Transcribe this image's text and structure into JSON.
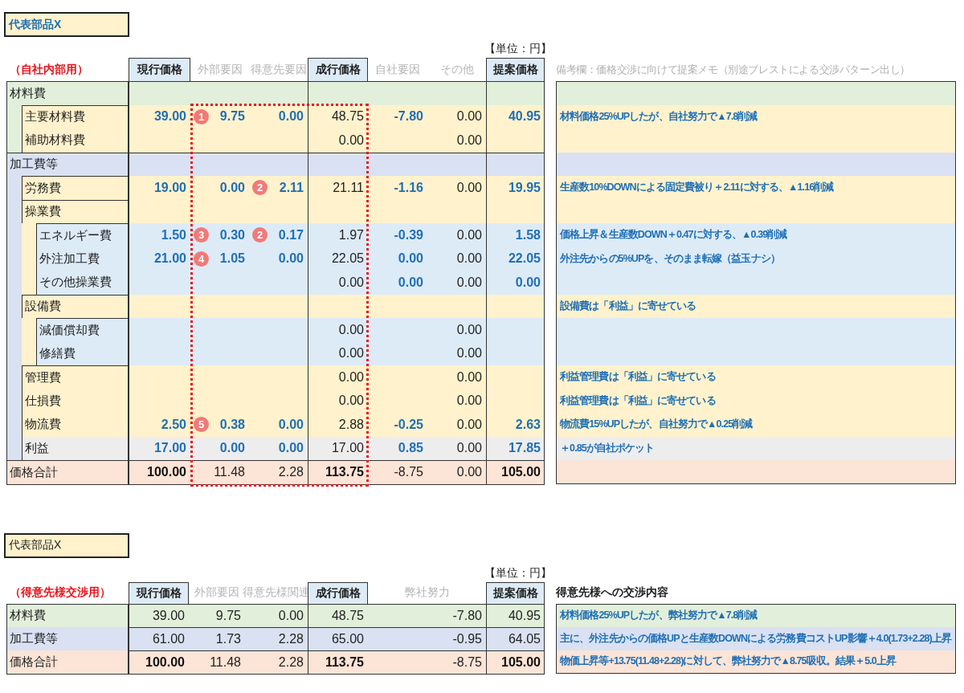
{
  "internal": {
    "title": {
      "text": "代表部品X",
      "kind": "input"
    },
    "unit": "【単位：円】",
    "audience": "（自社内部用）",
    "columns": [
      {
        "label": "現行価格",
        "kind": "key"
      },
      {
        "label": "外部要因",
        "kind": "factor"
      },
      {
        "label": "得意先要因",
        "kind": "factor"
      },
      {
        "label": "成行価格",
        "kind": "key"
      },
      {
        "label": "自社要因",
        "kind": "factor"
      },
      {
        "label": "その他",
        "kind": "factor"
      },
      {
        "label": "提案価格",
        "kind": "key"
      }
    ],
    "remarks_heading": {
      "text": "備考欄：価格交渉に向けて提案メモ（別途ブレストによる交渉パターン出し）",
      "kind": "hint"
    },
    "rows": [
      {
        "label": "材料費",
        "color": "#e2efda",
        "cells": [
          null,
          null,
          null,
          null,
          null,
          null,
          null
        ],
        "children": [
          {
            "label": "主要材料費",
            "color": "#fff2cc",
            "cells": [
              {
                "v": "39.00",
                "kind": "input"
              },
              {
                "v": "9.75",
                "kind": "input",
                "marker": "1"
              },
              {
                "v": "0.00",
                "kind": "input"
              },
              {
                "v": "48.75",
                "kind": "calc"
              },
              {
                "v": "-7.80",
                "kind": "input"
              },
              {
                "v": "0.00",
                "kind": "calc"
              },
              {
                "v": "40.95",
                "kind": "input"
              }
            ],
            "remark": "材料価格25%UPしたが、自社努力で▲7.8削減"
          },
          {
            "label": "補助材料費",
            "color": "#fff2cc",
            "cells": [
              null,
              null,
              null,
              {
                "v": "0.00",
                "kind": "calc"
              },
              null,
              {
                "v": "0.00",
                "kind": "calc"
              },
              null
            ]
          }
        ]
      },
      {
        "label": "加工費等",
        "color": "#d9e1f2",
        "cells": [
          null,
          null,
          null,
          null,
          null,
          null,
          null
        ],
        "children": [
          {
            "label": "労務費",
            "color": "#fff2cc",
            "cells": [
              {
                "v": "19.00",
                "kind": "input"
              },
              {
                "v": "0.00",
                "kind": "input"
              },
              {
                "v": "2.11",
                "kind": "input",
                "marker": "2"
              },
              {
                "v": "21.11",
                "kind": "calc"
              },
              {
                "v": "-1.16",
                "kind": "input"
              },
              {
                "v": "0.00",
                "kind": "calc"
              },
              {
                "v": "19.95",
                "kind": "input"
              }
            ],
            "remark": "生産数10%DOWNによる固定費被り＋2.11に対する、▲1.16削減"
          },
          {
            "label": "操業費",
            "color": "#fff2cc",
            "cells": [
              null,
              null,
              null,
              null,
              null,
              null,
              null
            ],
            "children": [
              {
                "label": "エネルギー費",
                "color": "#ddebf7",
                "cells": [
                  {
                    "v": "1.50",
                    "kind": "input"
                  },
                  {
                    "v": "0.30",
                    "kind": "input",
                    "marker": "3"
                  },
                  {
                    "v": "0.17",
                    "kind": "input",
                    "marker": "2"
                  },
                  {
                    "v": "1.97",
                    "kind": "calc"
                  },
                  {
                    "v": "-0.39",
                    "kind": "input"
                  },
                  {
                    "v": "0.00",
                    "kind": "calc"
                  },
                  {
                    "v": "1.58",
                    "kind": "input"
                  }
                ],
                "remark": "価格上昇＆生産数DOWN＋0.47に対する、▲0.39削減"
              },
              {
                "label": "外注加工費",
                "color": "#ddebf7",
                "cells": [
                  {
                    "v": "21.00",
                    "kind": "input"
                  },
                  {
                    "v": "1.05",
                    "kind": "input",
                    "marker": "4"
                  },
                  {
                    "v": "0.00",
                    "kind": "input"
                  },
                  {
                    "v": "22.05",
                    "kind": "calc"
                  },
                  {
                    "v": "0.00",
                    "kind": "input"
                  },
                  {
                    "v": "0.00",
                    "kind": "calc"
                  },
                  {
                    "v": "22.05",
                    "kind": "input"
                  }
                ],
                "remark": "外注先からの5%UPを、そのまま転嫁（益玉ナシ）"
              },
              {
                "label": "その他操業費",
                "color": "#ddebf7",
                "cells": [
                  null,
                  null,
                  null,
                  {
                    "v": "0.00",
                    "kind": "calc"
                  },
                  {
                    "v": "0.00",
                    "kind": "input"
                  },
                  {
                    "v": "0.00",
                    "kind": "calc"
                  },
                  {
                    "v": "0.00",
                    "kind": "input"
                  }
                ]
              }
            ]
          },
          {
            "label": "設備費",
            "color": "#fff2cc",
            "cells": [
              null,
              null,
              null,
              null,
              null,
              null,
              null
            ],
            "remark": "設備費は「利益」に寄せている",
            "children": [
              {
                "label": "減価償却費",
                "color": "#ddebf7",
                "cells": [
                  null,
                  null,
                  null,
                  {
                    "v": "0.00",
                    "kind": "calc"
                  },
                  null,
                  {
                    "v": "0.00",
                    "kind": "calc"
                  },
                  null
                ]
              },
              {
                "label": "修繕費",
                "color": "#ddebf7",
                "cells": [
                  null,
                  null,
                  null,
                  {
                    "v": "0.00",
                    "kind": "calc"
                  },
                  null,
                  {
                    "v": "0.00",
                    "kind": "calc"
                  },
                  null
                ]
              }
            ]
          },
          {
            "label": "管理費",
            "color": "#fff2cc",
            "cells": [
              null,
              null,
              null,
              {
                "v": "0.00",
                "kind": "calc"
              },
              null,
              {
                "v": "0.00",
                "kind": "calc"
              },
              null
            ],
            "remark": "利益管理費は「利益」に寄せている"
          },
          {
            "label": "仕損費",
            "color": "#fff2cc",
            "cells": [
              null,
              null,
              null,
              {
                "v": "0.00",
                "kind": "calc"
              },
              null,
              {
                "v": "0.00",
                "kind": "calc"
              },
              null
            ],
            "remark": "利益管理費は「利益」に寄せている"
          },
          {
            "label": "物流費",
            "color": "#fff2cc",
            "cells": [
              {
                "v": "2.50",
                "kind": "input"
              },
              {
                "v": "0.38",
                "kind": "input",
                "marker": "5"
              },
              {
                "v": "0.00",
                "kind": "input"
              },
              {
                "v": "2.88",
                "kind": "calc"
              },
              {
                "v": "-0.25",
                "kind": "input"
              },
              {
                "v": "0.00",
                "kind": "calc"
              },
              {
                "v": "2.63",
                "kind": "input"
              }
            ],
            "remark": "物流費15%UPしたが、自社努力で▲0.25削減"
          },
          {
            "label": "利益",
            "color": "#ededed",
            "cells": [
              {
                "v": "17.00",
                "kind": "input"
              },
              {
                "v": "0.00",
                "kind": "input"
              },
              {
                "v": "0.00",
                "kind": "input"
              },
              {
                "v": "17.00",
                "kind": "calc"
              },
              {
                "v": "0.85",
                "kind": "input"
              },
              {
                "v": "0.00",
                "kind": "calc"
              },
              {
                "v": "17.85",
                "kind": "input"
              }
            ],
            "remark": "＋0.85が自社ポケット"
          }
        ]
      },
      {
        "label": "価格合計",
        "color": "#fce4d6",
        "cells": [
          {
            "v": "100.00",
            "kind": "bold"
          },
          {
            "v": "11.48",
            "kind": "calc"
          },
          {
            "v": "2.28",
            "kind": "calc"
          },
          {
            "v": "113.75",
            "kind": "bold"
          },
          {
            "v": "-8.75",
            "kind": "calc"
          },
          {
            "v": "0.00",
            "kind": "calc"
          },
          {
            "v": "105.00",
            "kind": "bold"
          }
        ]
      }
    ]
  },
  "customer": {
    "title": {
      "text": "代表部品X",
      "kind": "plain"
    },
    "unit": "【単位：円】",
    "audience": "（得意先様交渉用）",
    "columns": [
      {
        "label": "現行価格",
        "kind": "key"
      },
      {
        "label": "外部要因",
        "kind": "factor"
      },
      {
        "label": "得意先様関連",
        "kind": "factor"
      },
      {
        "label": "成行価格",
        "kind": "key"
      },
      {
        "label": "弊社努力",
        "kind": "factor"
      },
      {
        "label": "提案価格",
        "kind": "key"
      }
    ],
    "remarks_heading": {
      "text": "得意先様への交渉内容",
      "kind": "title"
    },
    "rows": [
      {
        "label": "材料費",
        "color": "#e2efda",
        "cells": [
          {
            "v": "39.00",
            "kind": "calc"
          },
          {
            "v": "9.75",
            "kind": "calc"
          },
          {
            "v": "0.00",
            "kind": "calc"
          },
          {
            "v": "48.75",
            "kind": "calc"
          },
          {
            "v": "-7.80",
            "kind": "calc"
          },
          {
            "v": "40.95",
            "kind": "calc"
          }
        ],
        "remark": "材料価格25%UPしたが、弊社努力で▲7.8削減"
      },
      {
        "label": "加工費等",
        "color": "#d9e1f2",
        "cells": [
          {
            "v": "61.00",
            "kind": "calc"
          },
          {
            "v": "1.73",
            "kind": "calc"
          },
          {
            "v": "2.28",
            "kind": "calc"
          },
          {
            "v": "65.00",
            "kind": "calc"
          },
          {
            "v": "-0.95",
            "kind": "calc"
          },
          {
            "v": "64.05",
            "kind": "calc"
          }
        ],
        "remark": "主に、外注先からの価格UPと生産数DOWNによる労務費コストUP影響＋4.0(1.73+2.28)上昇"
      },
      {
        "label": "価格合計",
        "color": "#fce4d6",
        "cells": [
          {
            "v": "100.00",
            "kind": "bold"
          },
          {
            "v": "11.48",
            "kind": "calc"
          },
          {
            "v": "2.28",
            "kind": "calc"
          },
          {
            "v": "113.75",
            "kind": "bold"
          },
          {
            "v": "-8.75",
            "kind": "calc"
          },
          {
            "v": "105.00",
            "kind": "bold"
          }
        ],
        "remark": "物価上昇等+13.75(11.48+2.28)に対して、弊社努力で▲8.75吸収。結果＋5.0上昇"
      }
    ]
  }
}
